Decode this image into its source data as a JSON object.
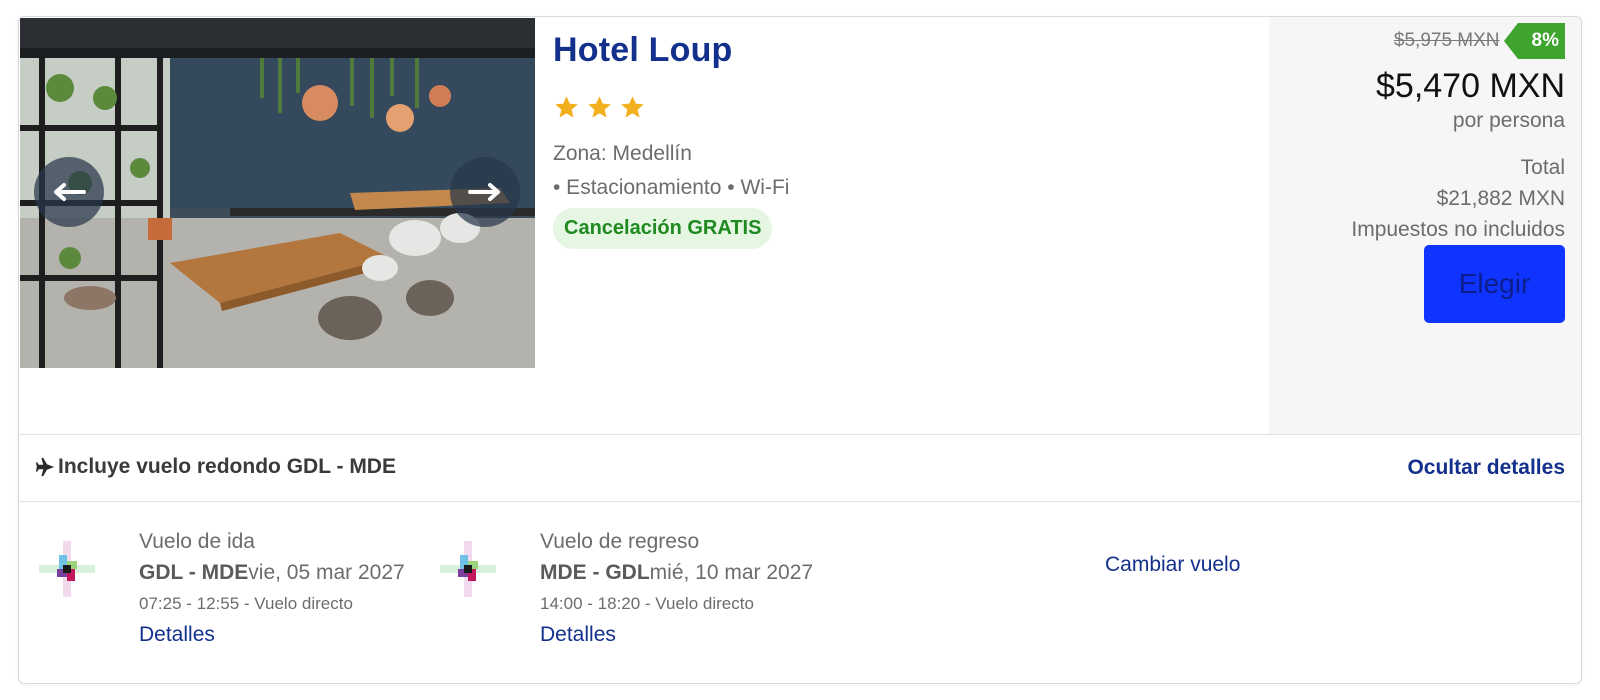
{
  "hotel": {
    "name": "Hotel Loup",
    "stars": 3,
    "zone": "Zona: Medellín",
    "amenities": "• Estacionamiento • Wi-Fi",
    "cancellation": "Cancelación GRATIS"
  },
  "gallery": {
    "prev_icon": "arrow-left-icon",
    "next_icon": "arrow-right-icon"
  },
  "pricing": {
    "old_price": "$5,975 MXN",
    "discount": "8%",
    "price": "$5,470 MXN",
    "per_person": "por persona",
    "total_label": "Total",
    "total_value": "$21,882 MXN",
    "taxes_note": "Impuestos no incluidos",
    "choose_label": "Elegir"
  },
  "flight_bar": {
    "icon": "airplane-icon",
    "summary": "Incluye vuelo redondo GDL - MDE",
    "hide_details": "Ocultar detalles"
  },
  "flights": {
    "outbound": {
      "title": "Vuelo de ida",
      "route": "GDL - MDE",
      "date": "vie, 05 mar 2027",
      "times": "07:25 - 12:55 - Vuelo directo",
      "details": "Detalles"
    },
    "return": {
      "title": "Vuelo de regreso",
      "route": "MDE - GDL",
      "date": "mié, 10 mar 2027",
      "times": "14:00 - 18:20 - Vuelo directo",
      "details": "Detalles"
    },
    "change": "Cambiar vuelo"
  },
  "colors": {
    "brand": "#12308c",
    "button": "#1034ff",
    "discount": "#3ea42e",
    "cancel_bg": "#e5f6e3",
    "star": "#f2b01e"
  }
}
